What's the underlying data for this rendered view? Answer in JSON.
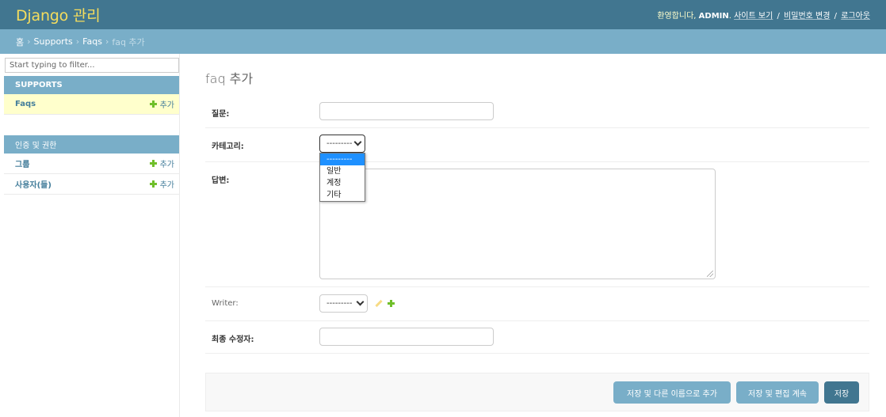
{
  "header": {
    "site_name": "Django 관리",
    "welcome": "환영합니다,",
    "username": "ADMIN",
    "view_site": "사이트 보기",
    "change_password": "비밀번호 변경",
    "logout": "로그아웃",
    "separator": "/"
  },
  "breadcrumb": {
    "home": "홈",
    "app": "Supports",
    "model": "Faqs",
    "current": "faq 추가",
    "separator": "›"
  },
  "sidebar": {
    "filter_placeholder": "Start typing to filter...",
    "apps": [
      {
        "caption": "SUPPORTS",
        "models": [
          {
            "name": "Faqs",
            "add_label": "추가"
          }
        ]
      },
      {
        "caption": "인증 및 권한",
        "models": [
          {
            "name": "그룹",
            "add_label": "추가"
          },
          {
            "name": "사용자(들)",
            "add_label": "추가"
          }
        ]
      }
    ]
  },
  "main": {
    "title": "faq 추가",
    "fields": {
      "question": {
        "label": "질문:"
      },
      "category": {
        "label": "카테고리:",
        "selected": "---------"
      },
      "answer": {
        "label": "답변:"
      },
      "writer": {
        "label": "Writer:",
        "selected": "---------"
      },
      "last_editor": {
        "label": "최종 수정자:"
      }
    },
    "category_options": [
      "---------",
      "일반",
      "계정",
      "기타"
    ],
    "buttons": {
      "save_add_another": "저장 및 다른 이름으로 추가",
      "save_continue": "저장 및 편집 계속",
      "save": "저장"
    }
  },
  "colors": {
    "header_bg": "#417690",
    "site_name": "#f5dd5d",
    "breadcrumb_bg": "#79aec8",
    "link": "#447e9b",
    "add_icon": "#70bf2b",
    "selected_row": "#ffffcc",
    "dropdown_highlight": "#1e90ff"
  },
  "icons": {
    "add": "plus-icon",
    "edit": "pencil-icon",
    "select": "chevron-down-icon"
  }
}
